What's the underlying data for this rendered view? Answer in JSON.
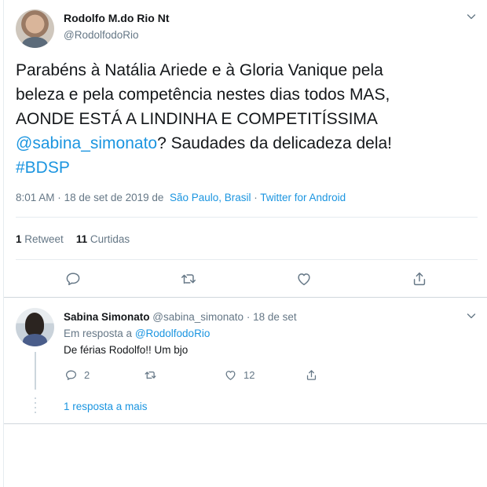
{
  "tweet": {
    "author_name": "Rodolfo M.do Rio Nt",
    "author_handle": "@RodolfodoRio",
    "text_lines": [
      "Parabéns à Natália Ariede e à Gloria Vanique pela",
      "beleza e pela competência nestes dias todos MAS,",
      "AONDE ESTÁ A LINDINHA E COMPETITÍSSIMA"
    ],
    "mention": "@sabina_simonato",
    "text_after_mention": "? Saudades da delicadeza dela!",
    "hashtag": "#BDSP",
    "time": "8:01 AM",
    "date": "18 de set de 2019 de",
    "location": "São Paulo, Brasil",
    "separator": "·",
    "source": "Twitter for Android",
    "retweets_count": "1",
    "retweets_label": "Retweet",
    "likes_count": "11",
    "likes_label": "Curtidas"
  },
  "reply": {
    "author_name": "Sabina Simonato",
    "author_handle": "@sabina_simonato",
    "separator": "·",
    "date": "18 de set",
    "in_reply_prefix": "Em resposta a",
    "in_reply_handle": "@RodolfodoRio",
    "text": "De férias Rodolfo!! Um bjo",
    "reply_count": "2",
    "retweet_count": "",
    "like_count": "12",
    "more_replies": "1 resposta a mais"
  },
  "icons": {
    "caret": "chevron-down-icon",
    "reply": "reply-icon",
    "retweet": "retweet-icon",
    "like": "heart-icon",
    "share": "share-icon"
  },
  "colors": {
    "link": "#1b95e0",
    "muted": "#657786",
    "text": "#14171a",
    "divider": "#e6ecf0"
  }
}
